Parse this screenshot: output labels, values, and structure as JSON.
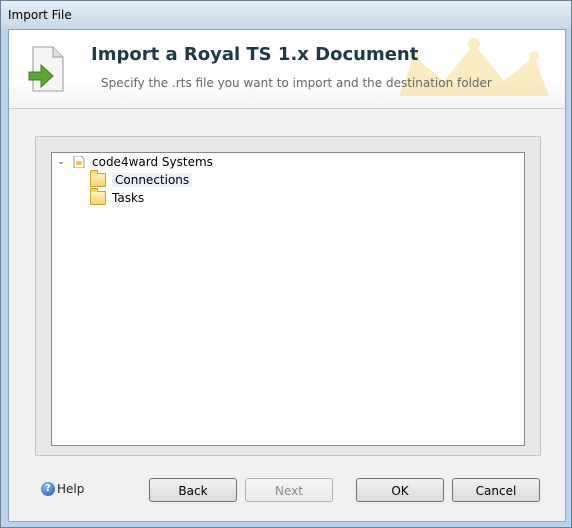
{
  "window": {
    "title": "Import File"
  },
  "header": {
    "title": "Import a Royal TS 1.x Document",
    "subtitle": "Specify the .rts file you want to import and the destination folder"
  },
  "tree": {
    "root": {
      "label": "code4ward Systems",
      "expanded": true
    },
    "children": [
      {
        "label": "Connections",
        "selected": true
      },
      {
        "label": "Tasks",
        "selected": false
      }
    ]
  },
  "footer": {
    "help_label": "Help",
    "back_label": "Back",
    "next_label": "Next",
    "ok_label": "OK",
    "cancel_label": "Cancel"
  }
}
